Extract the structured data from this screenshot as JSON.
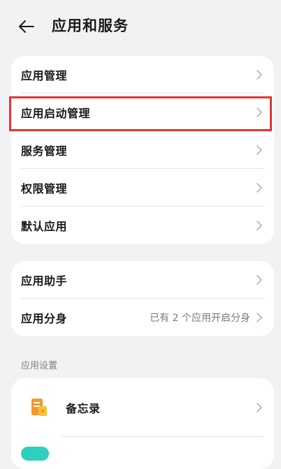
{
  "header": {
    "title": "应用和服务"
  },
  "group1": [
    {
      "label": "应用管理"
    },
    {
      "label": "应用启动管理"
    },
    {
      "label": "服务管理"
    },
    {
      "label": "权限管理"
    },
    {
      "label": "默认应用"
    }
  ],
  "group2": [
    {
      "label": "应用助手",
      "value": ""
    },
    {
      "label": "应用分身",
      "value": "已有 2 个应用开启分身"
    }
  ],
  "section": {
    "label": "应用设置"
  },
  "apps": [
    {
      "label": "备忘录",
      "icon": "notepad-icon"
    }
  ],
  "colors": {
    "highlight": "#e53535",
    "accent_orange": "#f29a2e",
    "accent_teal": "#2ecfbf"
  }
}
